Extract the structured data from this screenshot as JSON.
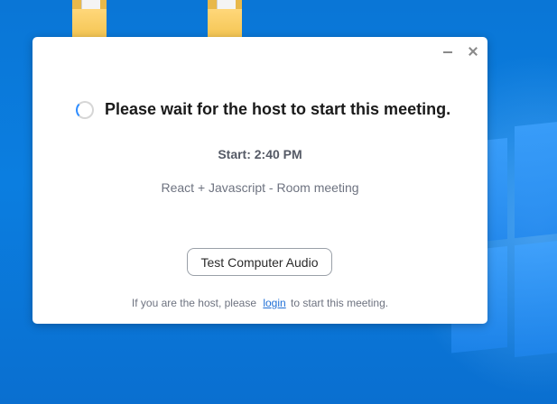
{
  "desktop": {
    "icons": [
      {
        "name": "folder-icon"
      },
      {
        "name": "folder-icon"
      }
    ]
  },
  "dialog": {
    "controls": {
      "minimize_icon": "minimize-icon",
      "close_icon": "close-icon"
    },
    "headline": "Please wait for the host to start this meeting.",
    "start_time": "Start: 2:40 PM",
    "meeting_topic": "React + Javascript - Room meeting",
    "test_audio_label": "Test Computer Audio",
    "host_note": {
      "prefix": "If you are the host, please",
      "link": "login",
      "suffix": "to start this meeting."
    }
  },
  "colors": {
    "accent": "#2d8cff",
    "link": "#1f6fd6",
    "desktop": "#0b7ee0"
  }
}
